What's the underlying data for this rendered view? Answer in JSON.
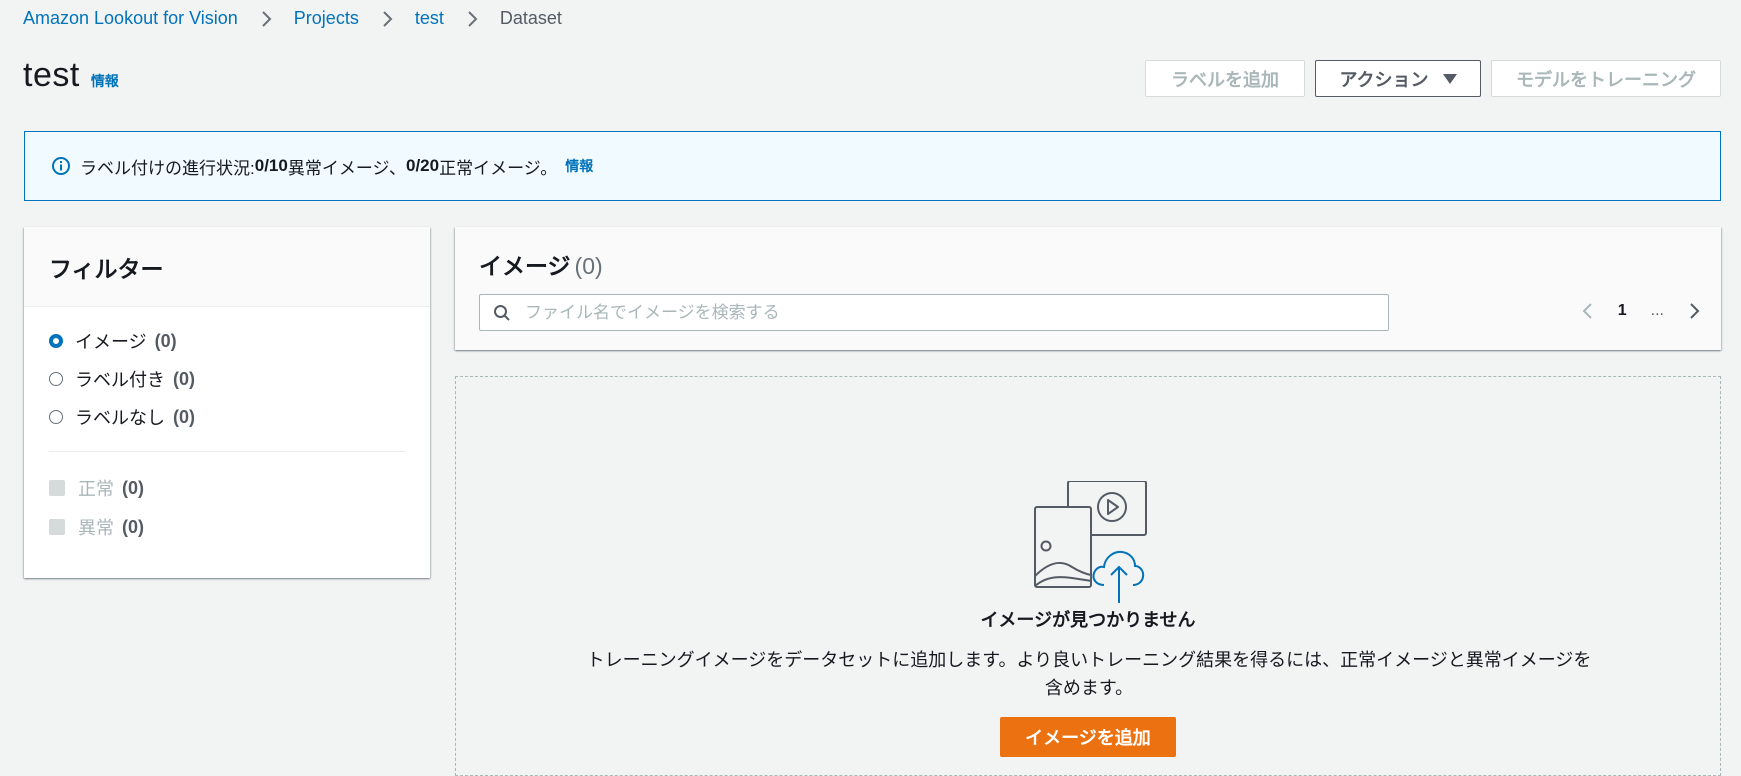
{
  "breadcrumb": {
    "items": [
      "Amazon Lookout for Vision",
      "Projects",
      "test"
    ],
    "current": "Dataset"
  },
  "header": {
    "title": "test",
    "info": "情報",
    "add_label_button": "ラベルを追加",
    "actions_button": "アクション",
    "train_model_button": "モデルをトレーニング"
  },
  "flash": {
    "prefix": "ラベル付けの進行状況: ",
    "anomaly_count": "0/10",
    "anomaly_text": " 異常イメージ、",
    "normal_count": "0/20",
    "normal_text": " 正常イメージ。",
    "info": "情報"
  },
  "filter": {
    "title": "フィルター",
    "radio_options": [
      {
        "label": "イメージ",
        "count": "(0)",
        "checked": true
      },
      {
        "label": "ラベル付き",
        "count": "(0)",
        "checked": false
      },
      {
        "label": "ラベルなし",
        "count": "(0)",
        "checked": false
      }
    ],
    "checkbox_options": [
      {
        "label": "正常",
        "count": "(0)"
      },
      {
        "label": "異常",
        "count": "(0)"
      }
    ]
  },
  "images": {
    "title": "イメージ",
    "count": "(0)",
    "search_placeholder": "ファイル名でイメージを検索する",
    "pagination": {
      "page": "1",
      "ellipsis": "..."
    }
  },
  "empty_state": {
    "title": "イメージが見つかりません",
    "description": "トレーニングイメージをデータセットに追加します。より良いトレーニング結果を得るには、正常イメージと異常イメージを含めます。",
    "add_images_button": "イメージを追加"
  },
  "colors": {
    "link": "#0073bb",
    "primary": "#ec7211",
    "background": "#f2f3f3",
    "flash_bg": "#f1faff"
  }
}
